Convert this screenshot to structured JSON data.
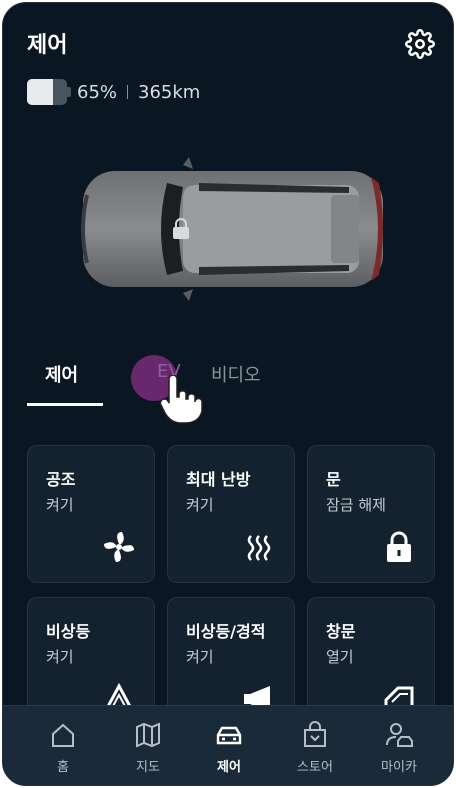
{
  "header": {
    "title": "제어"
  },
  "status": {
    "battery_percent": "65%",
    "range": "365km",
    "battery_level": 0.65
  },
  "tabs": [
    {
      "label": "제어",
      "active": true
    },
    {
      "label": "EV",
      "active": false
    },
    {
      "label": "비디오",
      "active": false
    }
  ],
  "cards": [
    {
      "name": "공조",
      "sub": "켜기",
      "icon": "fan-icon"
    },
    {
      "name": "최대 난방",
      "sub": "켜기",
      "icon": "heat-icon"
    },
    {
      "name": "문",
      "sub": "잠금 해제",
      "icon": "lock-icon"
    },
    {
      "name": "비상등",
      "sub": "켜기",
      "icon": "hazard-icon"
    },
    {
      "name": "비상등/경적",
      "sub": "켜기",
      "icon": "horn-icon"
    },
    {
      "name": "창문",
      "sub": "열기",
      "icon": "window-icon"
    }
  ],
  "nav": [
    {
      "label": "홈",
      "icon": "home-icon"
    },
    {
      "label": "지도",
      "icon": "map-icon"
    },
    {
      "label": "제어",
      "icon": "car-icon",
      "active": true
    },
    {
      "label": "스토어",
      "icon": "store-icon"
    },
    {
      "label": "마이카",
      "icon": "mycar-icon"
    }
  ],
  "colors": {
    "background": "#0a1622",
    "card": "#142230",
    "nav": "#1b2a38",
    "accent": "#7a2a7a"
  }
}
